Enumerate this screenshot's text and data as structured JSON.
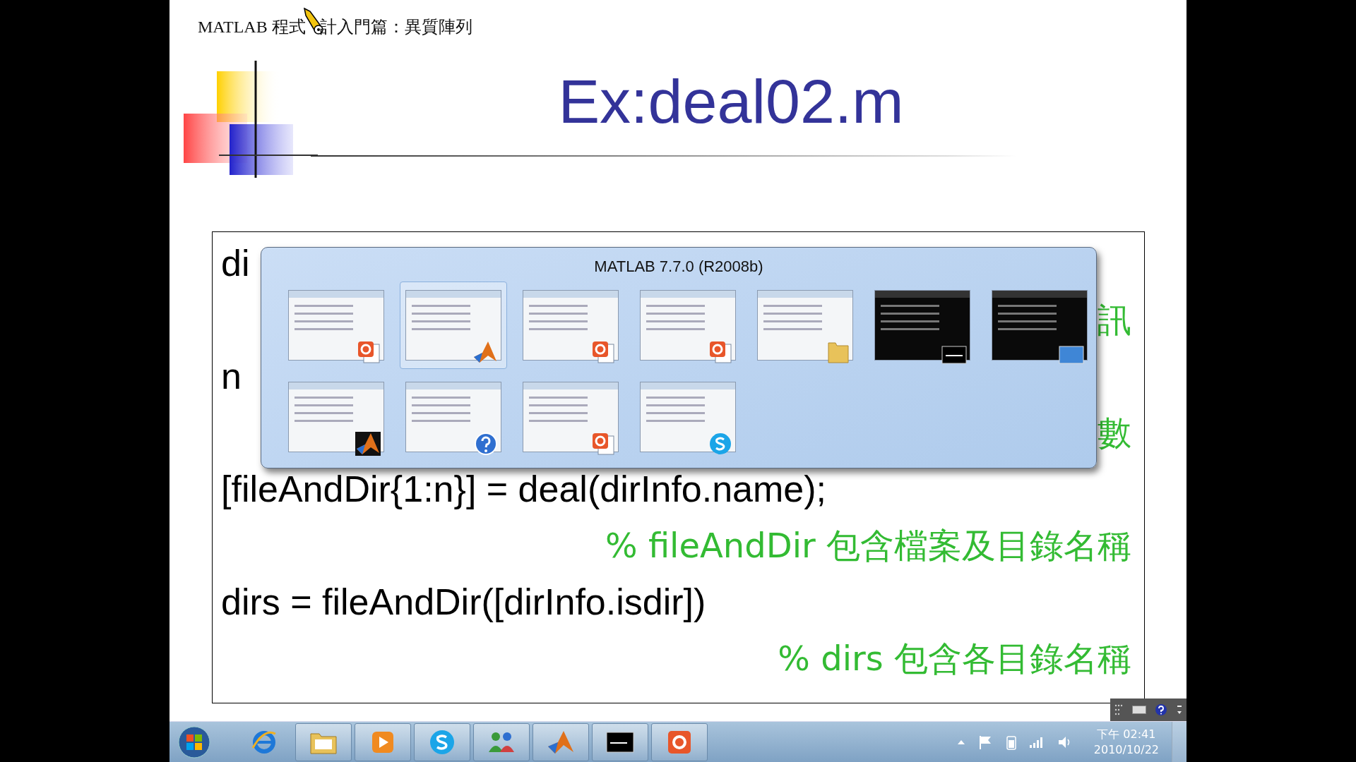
{
  "header": {
    "title_before_cursor": "MATLAB 程式",
    "title_after_cursor": "計入門篇：異質陣列"
  },
  "slide": {
    "title": "Ex:deal02.m"
  },
  "code_lines": [
    {
      "kind": "code",
      "text": "di"
    },
    {
      "kind": "comment",
      "text": "訊"
    },
    {
      "kind": "code",
      "text": "n"
    },
    {
      "kind": "comment",
      "text": "數"
    },
    {
      "kind": "code",
      "text": "[fileAndDir{1:n}] = deal(dirInfo.name);"
    },
    {
      "kind": "comment",
      "text": "% fileAndDir 包含檔案及目錄名稱"
    },
    {
      "kind": "code",
      "text": "dirs = fileAndDir([dirInfo.isdir])"
    },
    {
      "kind": "comment",
      "text": "% dirs 包含各目錄名稱"
    }
  ],
  "window_switcher": {
    "title": "MATLAB  7.7.0 (R2008b)",
    "thumbnails": [
      {
        "kind": "slide",
        "selected": false
      },
      {
        "kind": "matlab",
        "selected": true
      },
      {
        "kind": "powerpoint",
        "selected": false
      },
      {
        "kind": "window",
        "selected": false
      },
      {
        "kind": "explorer",
        "selected": false
      },
      {
        "kind": "console",
        "selected": false
      },
      {
        "kind": "desktop",
        "selected": false
      },
      {
        "kind": "figure",
        "selected": false
      },
      {
        "kind": "help",
        "selected": false
      },
      {
        "kind": "window",
        "selected": false
      },
      {
        "kind": "skype",
        "selected": false
      }
    ]
  },
  "taskbar": {
    "buttons": [
      {
        "kind": "browser",
        "running": false
      },
      {
        "kind": "explorer",
        "running": true
      },
      {
        "kind": "media",
        "running": true
      },
      {
        "kind": "skype",
        "running": true
      },
      {
        "kind": "people",
        "running": true
      },
      {
        "kind": "matlab",
        "running": true
      },
      {
        "kind": "console",
        "running": true
      },
      {
        "kind": "powerpoint",
        "running": true
      }
    ],
    "clock": {
      "time": "下午 02:41",
      "date": "2010/10/22"
    }
  }
}
